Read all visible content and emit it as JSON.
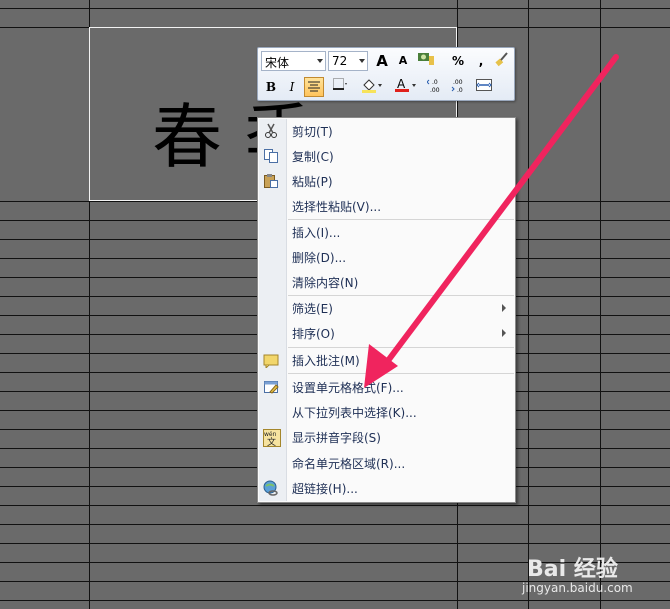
{
  "cell": {
    "text": "春 季"
  },
  "toolbar": {
    "font_name": "宋体",
    "font_size": "72",
    "grow_font": "A",
    "shrink_font": "A",
    "percent": "%",
    "comma": ",",
    "bold": "B",
    "italic": "I"
  },
  "menu": {
    "items": [
      {
        "label": "剪切(T)",
        "icon": "scissors-icon"
      },
      {
        "label": "复制(C)",
        "icon": "copy-icon"
      },
      {
        "label": "粘贴(P)",
        "icon": "paste-icon"
      },
      {
        "label": "选择性粘贴(V)...",
        "icon": ""
      },
      {
        "label": "插入(I)...",
        "icon": ""
      },
      {
        "label": "删除(D)...",
        "icon": ""
      },
      {
        "label": "清除内容(N)",
        "icon": ""
      },
      {
        "label": "筛选(E)",
        "icon": "",
        "submenu": true
      },
      {
        "label": "排序(O)",
        "icon": "",
        "submenu": true
      },
      {
        "label": "插入批注(M)",
        "icon": "comment-icon"
      },
      {
        "label": "设置单元格格式(F)...",
        "icon": "format-cells-icon"
      },
      {
        "label": "从下拉列表中选择(K)...",
        "icon": ""
      },
      {
        "label": "显示拼音字段(S)",
        "icon": "phonetic-icon"
      },
      {
        "label": "命名单元格区域(R)...",
        "icon": ""
      },
      {
        "label": "超链接(H)...",
        "icon": "hyperlink-icon"
      }
    ]
  },
  "watermark": {
    "brand": "Bai 经验",
    "url": "jingyan.baidu.com"
  },
  "colors": {
    "arrow": "#f0245e",
    "grid": "#000000",
    "background": "#6a6a6a",
    "font_color_bar": "#e0201b"
  }
}
